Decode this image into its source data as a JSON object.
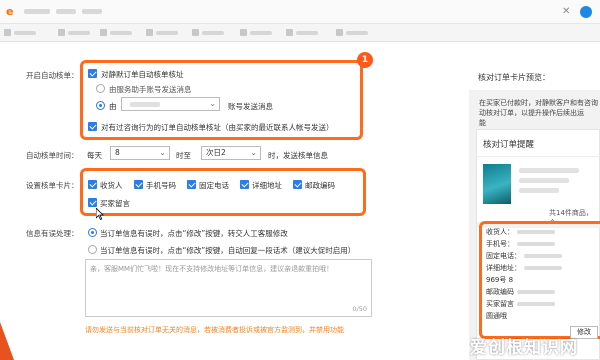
{
  "browser": {
    "logo_text": "e",
    "close_glyph": "✕",
    "icons": [
      "close-icon",
      "app-icon"
    ]
  },
  "form": {
    "auto_verify": {
      "label": "开启自动核单：",
      "main_checkbox": "对静默订单自动核单核址",
      "radio_service": "由服务助手账号发送消息",
      "radio_by": "由",
      "account_suffix": "账号发送消息",
      "consult_checkbox": "对有过咨询行为的订单自动核单核址（由买家的最近联系人帐号发送）"
    },
    "time": {
      "label": "自动核单时间：",
      "prefix": "每天",
      "from_value": "8",
      "to_label": "时至",
      "day_value": "次日2",
      "suffix": "时，发送核单信息"
    },
    "card_items": {
      "label": "设置核单卡片：",
      "items": [
        "收货人",
        "手机号码",
        "固定电话",
        "详细地址",
        "邮政编码",
        "买家留言"
      ]
    },
    "error_handling": {
      "label": "信息有误处理：",
      "option1": "当订单信息有误时，点击“修改”按键，转交人工客服修改",
      "option2": "当订单信息有误时，点击“修改”按键，自动回复一段话术（建议大促时启用）",
      "placeholder": "亲，客服MM们忙飞啦！现在不支持修改地址等订单信息，建议亲退款重拍哦！",
      "count": "0/50",
      "warning": "请勿发送与当前核对订单无关的消息，若被消费者投诉或被官方监测到，并禁用功能"
    },
    "highlight_badge": "1"
  },
  "preview": {
    "title": "核对订单卡片预览：",
    "desc_lines": [
      "在买家已付款时，对静默客户和有咨询",
      "动核对订单，以提升操作后续出运",
      "能"
    ],
    "card_title": "核对订单提醒",
    "total": "共14件商品，合",
    "info_rows": [
      "收货人：",
      "手机号：",
      "固定电话：",
      "详细地址：",
      "969号 8",
      "邮政编码",
      "买家留言",
      "圆通哦"
    ],
    "modify_button": "修改"
  },
  "watermark": "爱创根知识网",
  "colors": {
    "accent_orange": "#ff6b1a",
    "primary_blue": "#2b7de9",
    "warning_orange": "#f58220"
  }
}
